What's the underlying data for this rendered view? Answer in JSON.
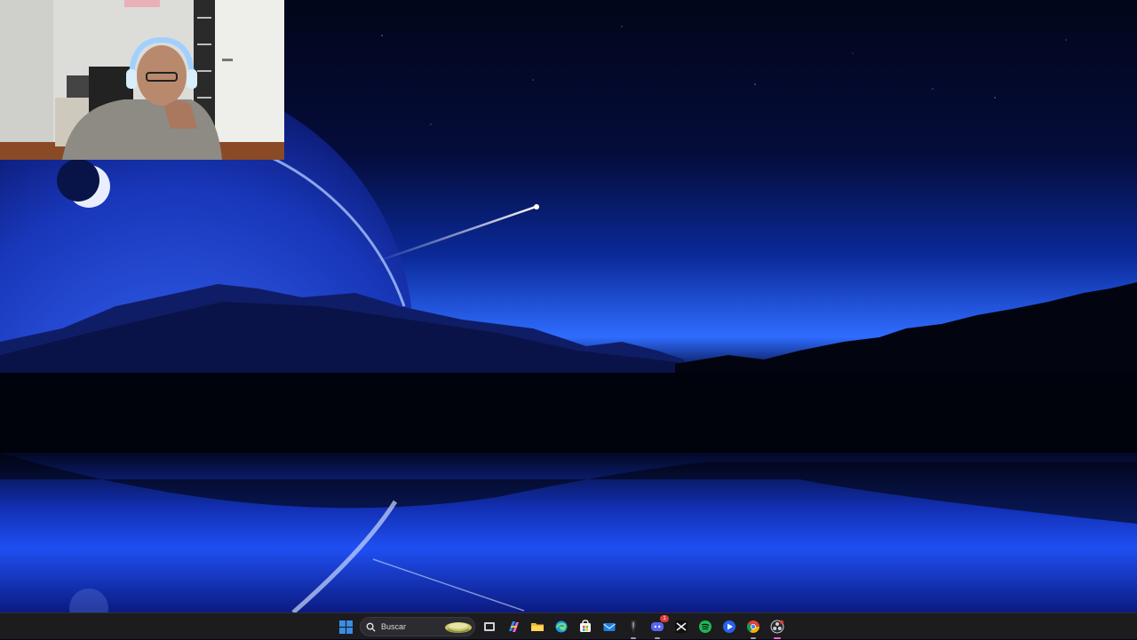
{
  "taskbar": {
    "search": {
      "label": "Buscar"
    },
    "apps": [
      {
        "id": "task-view",
        "icon": "task-view-icon"
      },
      {
        "id": "copilot",
        "icon": "copilot-icon"
      },
      {
        "id": "file-explorer",
        "icon": "folder-icon"
      },
      {
        "id": "edge",
        "icon": "edge-icon"
      },
      {
        "id": "store",
        "icon": "store-icon"
      },
      {
        "id": "mail",
        "icon": "mail-icon"
      },
      {
        "id": "tool",
        "icon": "dark-tool-icon"
      },
      {
        "id": "discord",
        "icon": "discord-icon",
        "badge": "1"
      },
      {
        "id": "capcut",
        "icon": "capcut-icon"
      },
      {
        "id": "spotify",
        "icon": "spotify-icon"
      },
      {
        "id": "media-player",
        "icon": "media-player-icon"
      },
      {
        "id": "chrome",
        "icon": "chrome-icon"
      },
      {
        "id": "obs",
        "icon": "obs-icon"
      }
    ]
  },
  "colors": {
    "taskbar_bg": "#1c1c1f",
    "start_blue": "#3a8ee6",
    "spotify_green": "#1db954",
    "sky_top": "#02061a",
    "sky_horizon": "#2f6cff"
  }
}
